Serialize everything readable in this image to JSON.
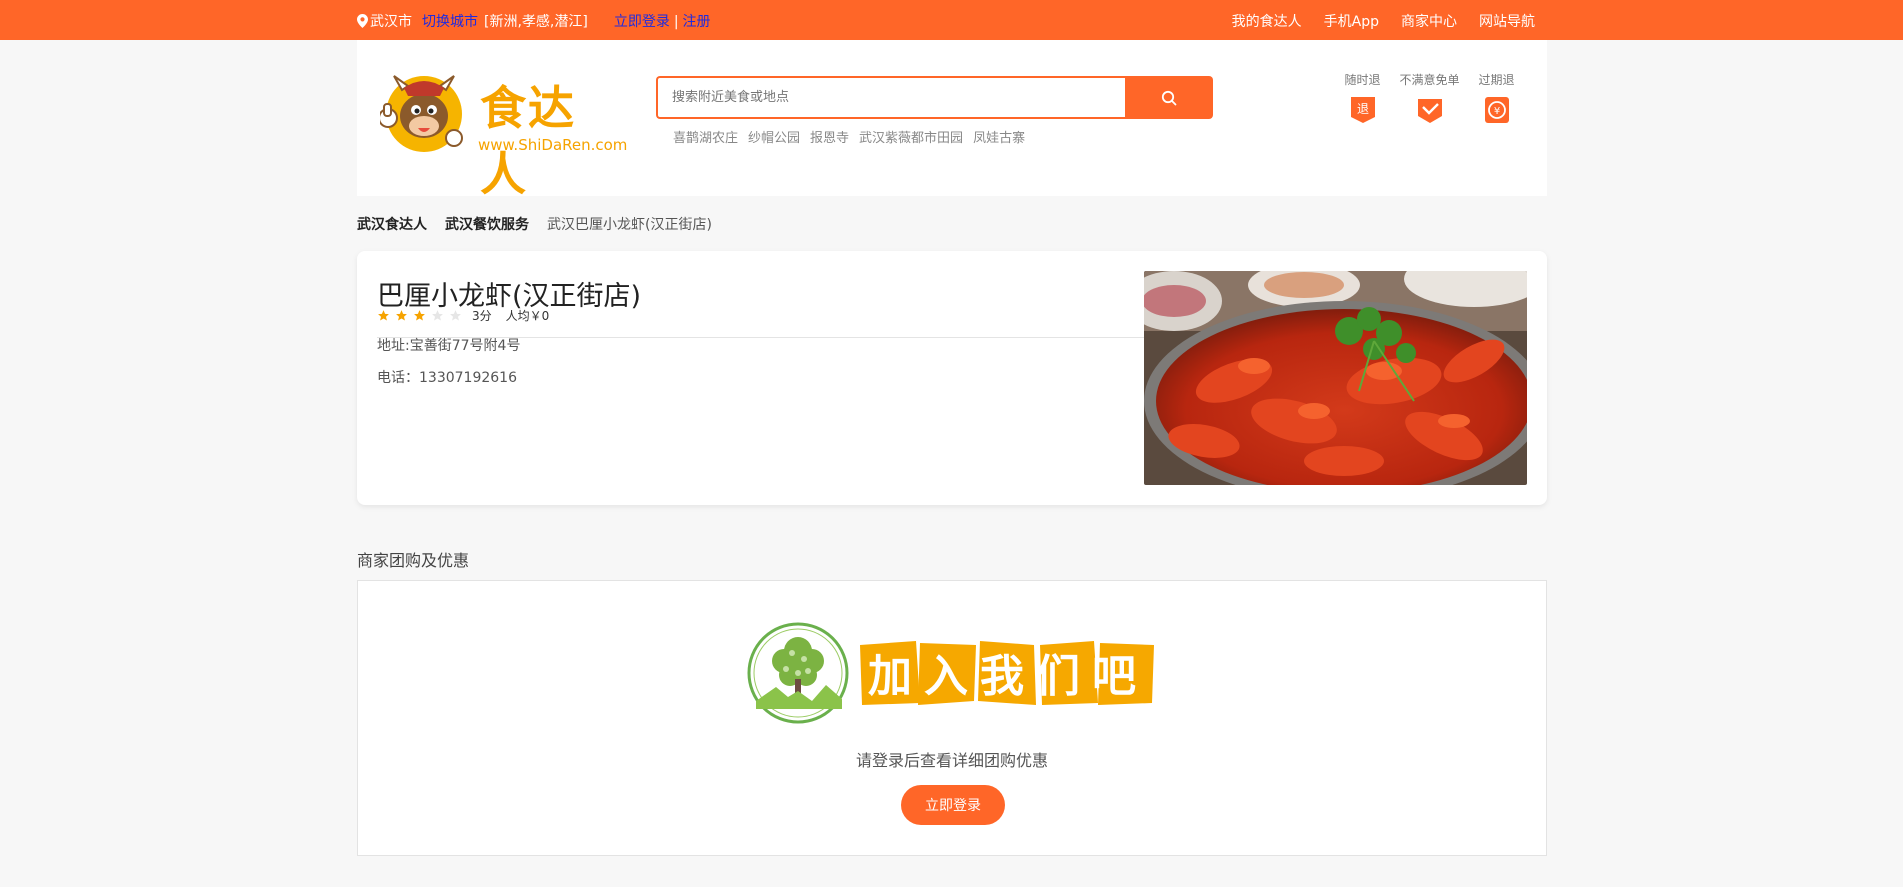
{
  "topbar": {
    "city": "武汉市",
    "switch_city": "切换城市",
    "nearby": "[新洲,孝感,潜江]",
    "login": "立即登录",
    "separator": "|",
    "register": "注册",
    "nav": [
      "我的食达人",
      "手机App",
      "商家中心",
      "网站导航"
    ]
  },
  "brand": {
    "name": "食达人",
    "url": "www.ShiDaRen.com",
    "accent_color": "#ff6628",
    "logo_color": "#f6a300"
  },
  "search": {
    "placeholder": "搜索附近美食或地点",
    "value": "",
    "icon": "search-icon",
    "hot_words": [
      "喜鹊湖农庄",
      "纱帽公园",
      "报恩寺",
      "武汉紫薇都市田园",
      "凤娃古寨"
    ]
  },
  "promises": [
    {
      "label": "随时退",
      "icon": "refund-icon"
    },
    {
      "label": "不满意免单",
      "icon": "check-icon"
    },
    {
      "label": "过期退",
      "icon": "yuan-icon"
    }
  ],
  "breadcrumb": {
    "items": [
      "武汉食达人",
      "武汉餐饮服务"
    ],
    "current": "武汉巴厘小龙虾(汉正街店)"
  },
  "shop": {
    "name": "巴厘小龙虾(汉正街店)",
    "rating_stars": 3,
    "rating_max": 5,
    "score": "3分",
    "avg_price": "人均￥0",
    "address": "地址:宝善街77号附4号",
    "phone": "电话：13307192616"
  },
  "deals": {
    "title": "商家团购及优惠",
    "join_text": "加入我们吧",
    "hint": "请登录后查看详细团购优惠",
    "login_button": "立即登录"
  }
}
